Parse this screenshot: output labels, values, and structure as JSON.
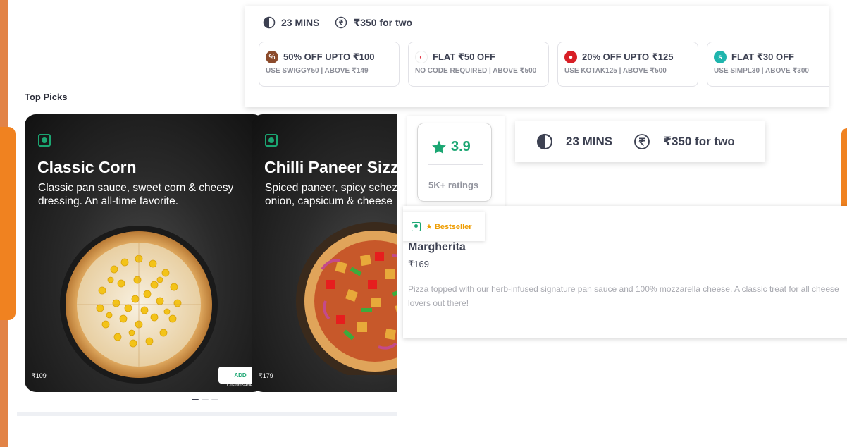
{
  "restaurant_info": {
    "delivery_time": "23 MINS",
    "cost_for_two": "₹350 for two"
  },
  "offers": [
    {
      "title": "50% OFF UPTO ₹100",
      "subtitle": "USE SWIGGY50 | ABOVE ₹149",
      "icon": "discount-icon",
      "color": "#8b4a2b"
    },
    {
      "title": "FLAT ₹50 OFF",
      "subtitle": "NO CODE REQUIRED | ABOVE ₹500",
      "icon": "bank-icon",
      "color": "#e23744"
    },
    {
      "title": "20% OFF UPTO ₹125",
      "subtitle": "USE KOTAK125 | ABOVE ₹500",
      "icon": "kotak-icon",
      "color": "#d81f26"
    },
    {
      "title": "FLAT ₹30 OFF",
      "subtitle": "USE SIMPL30 | ABOVE ₹300",
      "icon": "simpl-icon",
      "color": "#1fb5ad"
    }
  ],
  "top_picks": {
    "heading": "Top Picks",
    "items": [
      {
        "title": "Classic Corn",
        "description": "Classic pan sauce, sweet corn & cheesy dressing. An all-time favorite.",
        "price": "₹109",
        "add_label": "ADD",
        "customisable": "Customisable"
      },
      {
        "title": "Chilli Paneer Sizzler",
        "description": "Spiced paneer, spicy schezwan, tomato,  onion, capsicum & cheese",
        "price": "₹179"
      }
    ]
  },
  "rating": {
    "value": "3.9",
    "count": "5K+ ratings"
  },
  "time_card": {
    "delivery_time": "23 MINS",
    "cost_for_two": "₹350 for two"
  },
  "menu_item": {
    "badge": "Bestseller",
    "name": "Margherita",
    "price": "₹169",
    "description": "Pizza topped with our herb-infused signature pan sauce and 100% mozzarella cheese. A classic treat for all cheese lovers out there!"
  },
  "colors": {
    "accent": "#f08220",
    "veg": "#1ba672",
    "bestseller": "#ee9c00"
  }
}
